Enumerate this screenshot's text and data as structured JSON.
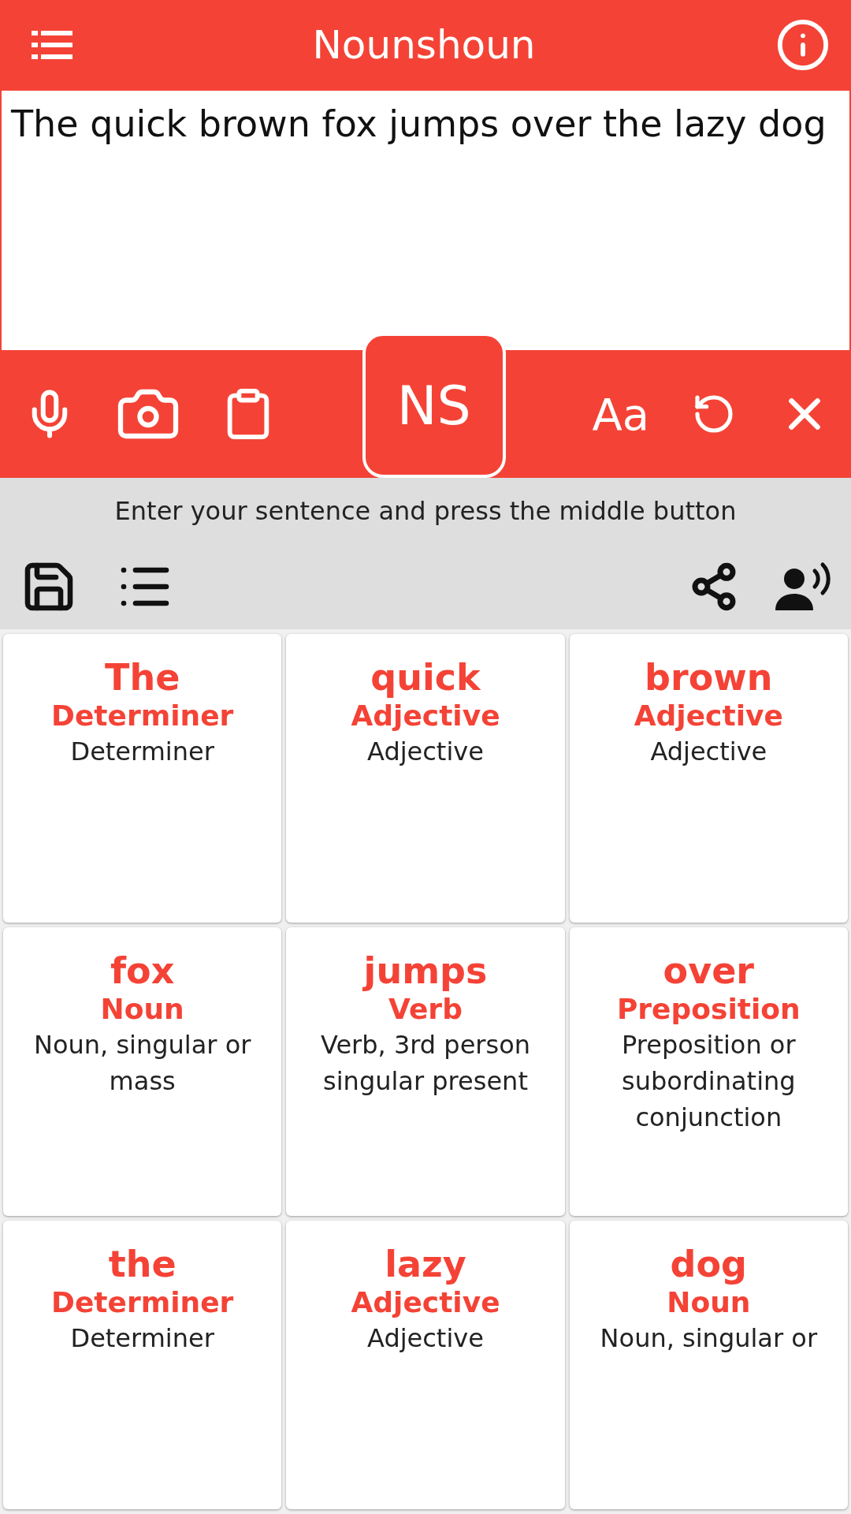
{
  "header": {
    "title": "Nounshoun"
  },
  "input": {
    "value": "The quick brown fox jumps over the lazy dog"
  },
  "toolbar": {
    "analyze_button": "NS",
    "font_button": "Aa"
  },
  "hint": "Enter your sentence and press the middle button",
  "words": [
    {
      "word": "The",
      "pos": "Determiner",
      "gloss": "Determiner"
    },
    {
      "word": "quick",
      "pos": "Adjective",
      "gloss": "Adjective"
    },
    {
      "word": "brown",
      "pos": "Adjective",
      "gloss": "Adjective"
    },
    {
      "word": "fox",
      "pos": "Noun",
      "gloss": "Noun, singular or mass"
    },
    {
      "word": "jumps",
      "pos": "Verb",
      "gloss": "Verb, 3rd person singular present"
    },
    {
      "word": "over",
      "pos": "Preposition",
      "gloss": "Preposition or subordinating conjunction"
    },
    {
      "word": "the",
      "pos": "Determiner",
      "gloss": "Determiner"
    },
    {
      "word": "lazy",
      "pos": "Adjective",
      "gloss": "Adjective"
    },
    {
      "word": "dog",
      "pos": "Noun",
      "gloss": "Noun, singular or"
    }
  ]
}
